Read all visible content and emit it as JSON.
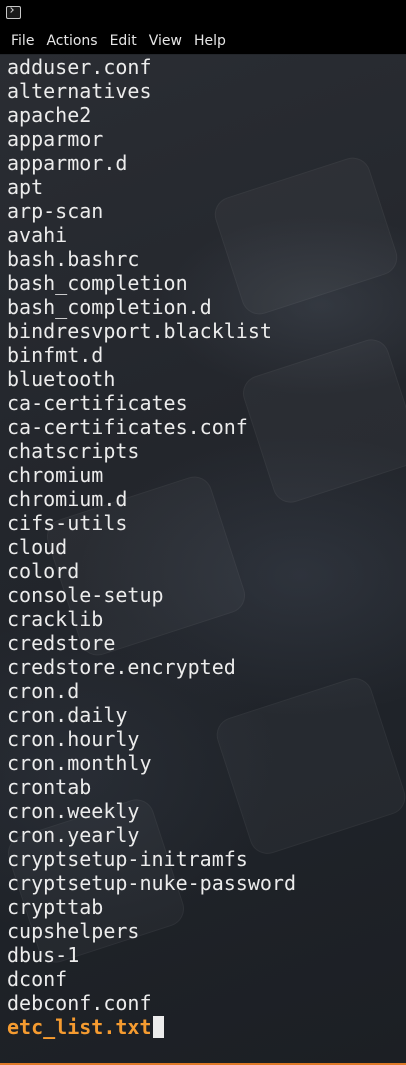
{
  "titlebar": {
    "icon": "terminal-icon"
  },
  "menu": {
    "items": [
      "File",
      "Actions",
      "Edit",
      "View",
      "Help"
    ]
  },
  "terminal": {
    "lines": [
      "adduser.conf",
      "alternatives",
      "apache2",
      "apparmor",
      "apparmor.d",
      "apt",
      "arp-scan",
      "avahi",
      "bash.bashrc",
      "bash_completion",
      "bash_completion.d",
      "bindresvport.blacklist",
      "binfmt.d",
      "bluetooth",
      "ca-certificates",
      "ca-certificates.conf",
      "chatscripts",
      "chromium",
      "chromium.d",
      "cifs-utils",
      "cloud",
      "colord",
      "console-setup",
      "cracklib",
      "credstore",
      "credstore.encrypted",
      "cron.d",
      "cron.daily",
      "cron.hourly",
      "cron.monthly",
      "crontab",
      "cron.weekly",
      "cron.yearly",
      "cryptsetup-initramfs",
      "cryptsetup-nuke-password",
      "crypttab",
      "cupshelpers",
      "dbus-1",
      "dconf",
      "debconf.conf"
    ],
    "current_input": "etc_list.txt"
  },
  "colors": {
    "text": "#ececec",
    "input_highlight": "#f59b30",
    "window_border": "#e07a28",
    "chrome": "#000000"
  }
}
